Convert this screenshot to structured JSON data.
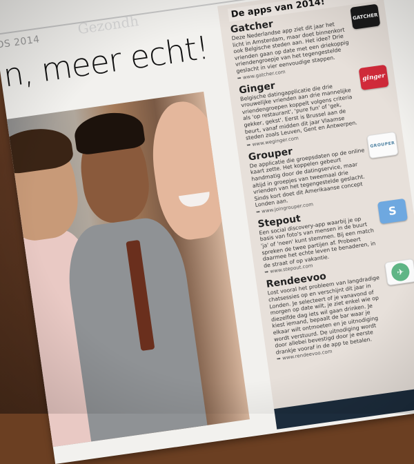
{
  "page": {
    "section_label": "DS 2014",
    "section_ghost": "Gezondh",
    "headline": "n, meer echt!"
  },
  "sidebar": {
    "title": "De apps van 2014!",
    "apps": [
      {
        "name": "Gatcher",
        "badge": "GATCHER",
        "description": "Deze Nederlandse app ziet dit jaar het licht in Amsterdam, maar doet binnenkort ook Belgische steden aan. Het idee? Drie vrienden gaan op date met een driekoppig vriendengroepje van het tegengestelde geslacht in vier eenvoudige stappen.",
        "url": "www.gatcher.com"
      },
      {
        "name": "Ginger",
        "badge": "ginger",
        "description": "Belgische datingapplicatie die drie vrouwelijke vrienden aan drie mannelijke vriendengroepen koppelt volgens criteria als 'op restaurant', 'pure fun' of 'gek, gekker, gekst'. Eerst is Brussel aan de beurt, vanaf midden dit jaar Vlaamse steden zoals Leuven, Gent en Antwerpen.",
        "url": "www.weginger.com"
      },
      {
        "name": "Grouper",
        "badge": "GROUPER",
        "description": "De applicatie die groepsdaten op de online kaart zette. Het koppelen gebeurt handmatig door de datingservice, maar altijd in groepjes van tweemaal drie vrienden van het tegengestelde geslacht. Sinds kort doet dit Amerikaanse concept Londen aan.",
        "url": "www.joingrouper.com"
      },
      {
        "name": "Stepout",
        "badge": "S",
        "description": "Een social discovery-app waarbij je op basis van foto's van mensen in de buurt 'ja' of 'neen' kunt stemmen. Bij een match spreken de twee partijen af. Probeert daarmee het echte leven te benaderen, in de straat of op vakantie.",
        "url": "www.stepout.com"
      },
      {
        "name": "Rendeevoo",
        "badge": "✈",
        "description": "Lost vooral het probleem van langdradige chatsessies op en verschijnt dit jaar in Londen. Je selecteert of je vanavond of morgen op date wilt, je ziet enkel wie op diezelfde dag iets wil gaan drinken. Je kiest iemand, bepaalt de bar waar je elkaar wilt ontmoeten en je uitnodiging wordt verstuurd. De uitnodiging wordt door allebei bevestigd door je eerste drankje vooraf in de app te betalen.",
        "url": "www.rendeevoo.com"
      }
    ]
  }
}
